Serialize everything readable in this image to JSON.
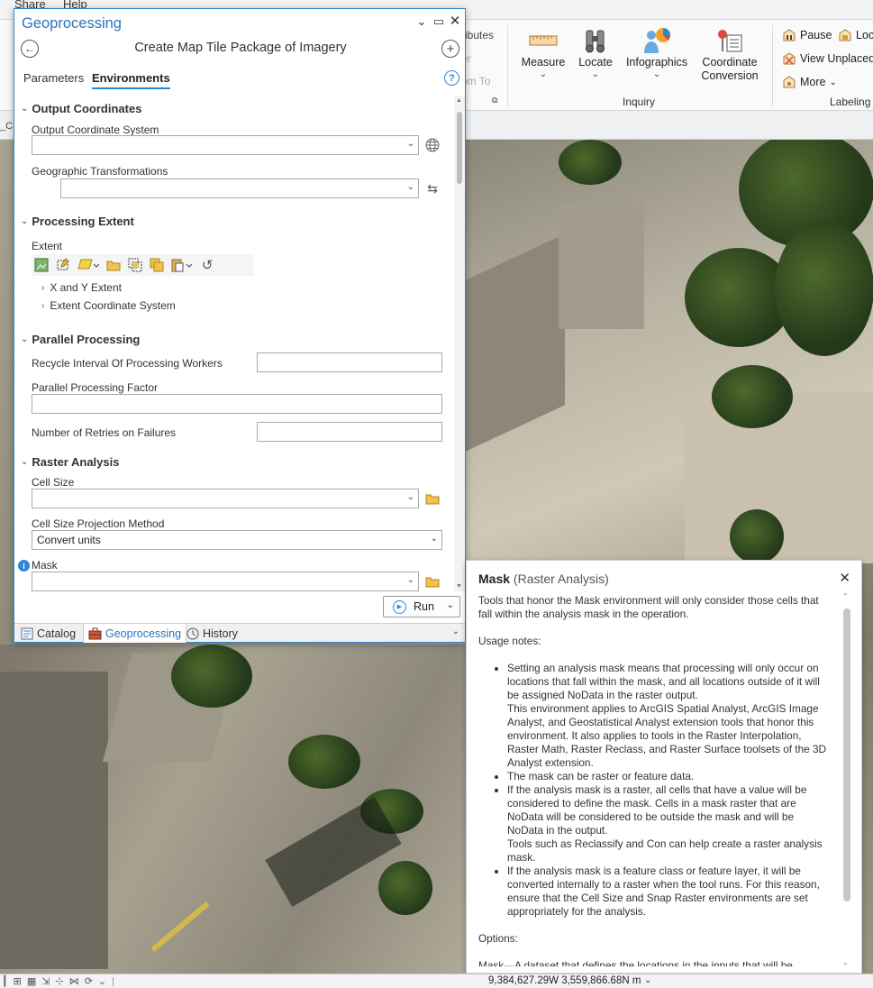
{
  "ribbon": {
    "top_menu": [
      "Share",
      "Help"
    ],
    "partial_items": [
      "ributes",
      "er",
      "om To"
    ],
    "inquiry": {
      "group_label": "Inquiry",
      "buttons": [
        {
          "label": "Measure",
          "icon": "ruler-icon",
          "has_dropdown": true
        },
        {
          "label": "Locate",
          "icon": "binoculars-icon",
          "has_dropdown": true
        },
        {
          "label": "Infographics",
          "icon": "infographics-icon",
          "has_dropdown": true
        },
        {
          "label": "Coordinate\nConversion",
          "icon": "coordinate-conversion-icon",
          "has_dropdown": false
        }
      ]
    },
    "labeling": {
      "group_label": "Labeling",
      "items": [
        {
          "label": "Pause",
          "icon": "pause-labels-icon"
        },
        {
          "label": "Loc",
          "icon": "lock-labels-icon"
        },
        {
          "label": "View Unplaced",
          "icon": "view-unplaced-icon"
        },
        {
          "label": "More",
          "icon": "more-labels-icon"
        }
      ]
    },
    "map_tab_fragment": "_C"
  },
  "geoprocessing": {
    "title": "Geoprocessing",
    "tool_name": "Create Map Tile Package of Imagery",
    "tabs": [
      {
        "label": "Parameters",
        "active": false
      },
      {
        "label": "Environments",
        "active": true
      }
    ],
    "sections": {
      "output_coordinates": {
        "title": "Output Coordinates",
        "output_coordinate_system": {
          "label": "Output Coordinate System",
          "value": ""
        },
        "geographic_transformations": {
          "label": "Geographic Transformations",
          "value": ""
        }
      },
      "processing_extent": {
        "title": "Processing Extent",
        "extent_label": "Extent",
        "sub_items": [
          "X and Y Extent",
          "Extent Coordinate System"
        ]
      },
      "parallel_processing": {
        "title": "Parallel Processing",
        "recycle_interval": {
          "label": "Recycle Interval Of Processing Workers",
          "value": ""
        },
        "parallel_factor": {
          "label": "Parallel Processing Factor",
          "value": ""
        },
        "retries": {
          "label": "Number of Retries on Failures",
          "value": ""
        }
      },
      "raster_analysis": {
        "title": "Raster Analysis",
        "cell_size": {
          "label": "Cell Size",
          "value": ""
        },
        "cell_size_projection": {
          "label": "Cell Size Projection Method",
          "value": "Convert units"
        },
        "mask": {
          "label": "Mask",
          "value": ""
        }
      }
    },
    "run_label": "Run",
    "bottom_tabs": [
      {
        "label": "Catalog",
        "icon": "catalog-icon",
        "active": false
      },
      {
        "label": "Geoprocessing",
        "icon": "toolbox-icon",
        "active": true
      },
      {
        "label": "History",
        "icon": "history-icon",
        "active": false
      }
    ]
  },
  "help_popup": {
    "title_bold": "Mask",
    "title_suffix": "(Raster Analysis)",
    "intro": "Tools that honor the Mask environment will only consider those cells that fall within the analysis mask in the operation.",
    "usage_heading": "Usage notes:",
    "notes": [
      "Setting an analysis mask means that processing will only occur on locations that fall within the mask, and all locations outside of it will be assigned NoData in the raster output.",
      "This environment applies to ArcGIS Spatial Analyst, ArcGIS Image Analyst, and Geostatistical Analyst extension tools that honor this environment. It also applies to tools in the Raster Interpolation, Raster Math, Raster Reclass, and Raster Surface toolsets of the 3D Analyst extension.",
      "The mask can be raster or feature data.",
      "If the analysis mask is a raster, all cells that have a value will be considered to define the mask. Cells in a mask raster that are NoData will be considered to be outside the mask and will be NoData in the output.",
      "Tools such as Reclassify and Con can help create a raster analysis mask.",
      "If the analysis mask is a feature class or feature layer, it will be converted internally to a raster when the tool runs. For this reason, ensure that the Cell Size and Snap Raster environments are set appropriately for the analysis."
    ],
    "options_heading": "Options:",
    "cutoff_line": "Mask—A dataset that defines the locations in the inputs that will be"
  },
  "status_bar": {
    "coordinates": "9,384,627.29W 3,559,866.68N m"
  },
  "colors": {
    "accent": "#2b88d8",
    "title_blue": "#2f73b8"
  }
}
